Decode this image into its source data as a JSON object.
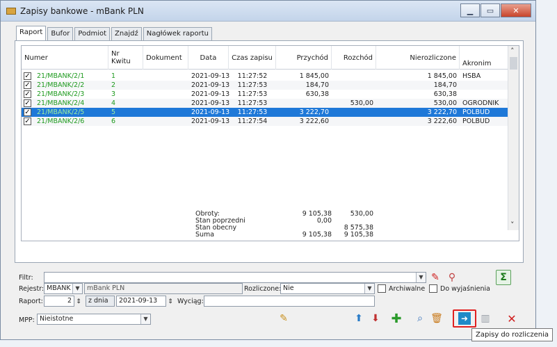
{
  "window": {
    "title": "Zapisy bankowe - mBank PLN"
  },
  "tabs": [
    "Raport",
    "Bufor",
    "Podmiot",
    "Znajdź",
    "Nagłówek raportu"
  ],
  "grid": {
    "columns": [
      "Numer",
      "Nr Kwitu",
      "Dokument",
      "Data",
      "Czas zapisu",
      "Przychód",
      "Rozchód",
      "Nierozliczone",
      "Akronim"
    ],
    "rows": [
      {
        "numer": "21/MBANK/2/1",
        "kwit": "1",
        "dokument": "",
        "data": "2021-09-13",
        "czas": "11:27:52",
        "przychod": "1 845,00",
        "rozchod": "",
        "nierozliczone": "1 845,00",
        "akronim": "HSBA"
      },
      {
        "numer": "21/MBANK/2/2",
        "kwit": "2",
        "dokument": "",
        "data": "2021-09-13",
        "czas": "11:27:53",
        "przychod": "184,70",
        "rozchod": "",
        "nierozliczone": "184,70",
        "akronim": ""
      },
      {
        "numer": "21/MBANK/2/3",
        "kwit": "3",
        "dokument": "",
        "data": "2021-09-13",
        "czas": "11:27:53",
        "przychod": "630,38",
        "rozchod": "",
        "nierozliczone": "630,38",
        "akronim": ""
      },
      {
        "numer": "21/MBANK/2/4",
        "kwit": "4",
        "dokument": "",
        "data": "2021-09-13",
        "czas": "11:27:53",
        "przychod": "",
        "rozchod": "530,00",
        "nierozliczone": "530,00",
        "akronim": "OGRODNIK"
      },
      {
        "numer": "21/MBANK/2/5",
        "kwit": "5",
        "dokument": "",
        "data": "2021-09-13",
        "czas": "11:27:53",
        "przychod": "3 222,70",
        "rozchod": "",
        "nierozliczone": "3 222,70",
        "akronim": "POLBUD"
      },
      {
        "numer": "21/MBANK/2/6",
        "kwit": "6",
        "dokument": "",
        "data": "2021-09-13",
        "czas": "11:27:54",
        "przychod": "3 222,60",
        "rozchod": "",
        "nierozliczone": "3 222,60",
        "akronim": "POLBUD"
      }
    ]
  },
  "totals": {
    "labels": [
      "Obroty:",
      "Stan poprzedni",
      "Stan obecny",
      "Suma"
    ],
    "obroty_przychod": "9 105,38",
    "obroty_rozchod": "530,00",
    "stan_poprzedni": "0,00",
    "stan_obecny": "8 575,38",
    "suma_przychod": "9 105,38",
    "suma_rozchod": "9 105,38"
  },
  "filters": {
    "filtr_label": "Filtr:",
    "rejestr_label": "Rejestr:",
    "rejestr_value": "MBANK",
    "rejestr_name": "mBank PLN",
    "rozliczone_label": "Rozliczone:",
    "rozliczone_value": "Nie",
    "archiwalne_label": "Archiwalne",
    "do_wyjasnienia_label": "Do wyjaśnienia",
    "raport_label": "Raport:",
    "raport_value": "2",
    "z_dnia_label": "z dnia",
    "z_dnia_value": "2021-09-13",
    "wyciag_label": "Wyciąg:",
    "mpp_label": "MPP:",
    "mpp_value": "Nieistotne"
  },
  "tooltip": "Zapisy do rozliczenia"
}
